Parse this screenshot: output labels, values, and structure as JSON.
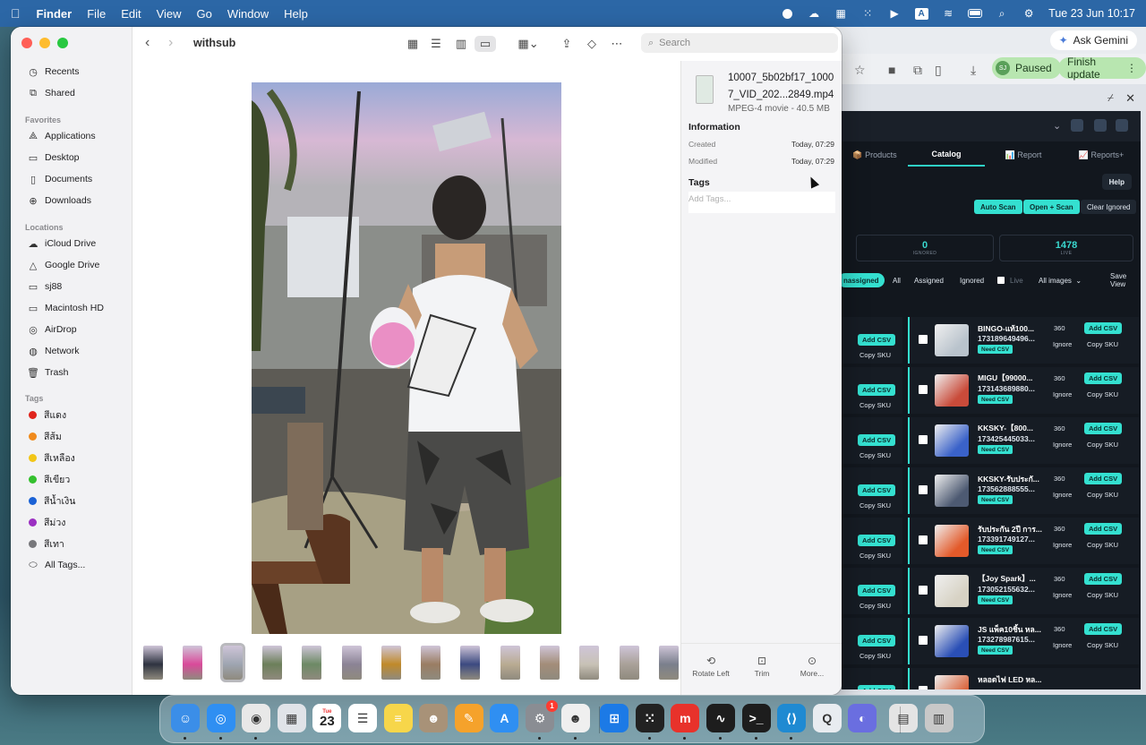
{
  "menubar": {
    "app": "Finder",
    "items": [
      "File",
      "Edit",
      "View",
      "Go",
      "Window",
      "Help"
    ],
    "datetime": "Tue 23 Jun  10:17",
    "status_icons": [
      "record-icon",
      "cloud-icon",
      "grid-icon",
      "dots-grid-icon",
      "play-icon",
      "keyboard-a-icon",
      "wifi-icon",
      "battery-icon",
      "search-icon",
      "control-center-icon"
    ],
    "keyboard_label": "A"
  },
  "finder": {
    "folder_title": "withsub",
    "search_placeholder": "Search",
    "sidebar": {
      "items_top": [
        {
          "label": "Recents",
          "icon": "clock-icon"
        },
        {
          "label": "Shared",
          "icon": "shared-folder-icon"
        }
      ],
      "favorites_header": "Favorites",
      "favorites": [
        {
          "label": "Applications",
          "icon": "applications-icon"
        },
        {
          "label": "Desktop",
          "icon": "desktop-icon"
        },
        {
          "label": "Documents",
          "icon": "document-icon"
        },
        {
          "label": "Downloads",
          "icon": "download-icon"
        }
      ],
      "locations_header": "Locations",
      "locations": [
        {
          "label": "iCloud Drive",
          "icon": "cloud-icon"
        },
        {
          "label": "Google Drive",
          "icon": "drive-icon"
        },
        {
          "label": "sj88",
          "icon": "external-disk-icon"
        },
        {
          "label": "Macintosh HD",
          "icon": "hard-disk-icon"
        },
        {
          "label": "AirDrop",
          "icon": "airdrop-icon"
        },
        {
          "label": "Network",
          "icon": "network-icon"
        },
        {
          "label": "Trash",
          "icon": "trash-icon"
        }
      ],
      "tags_header": "Tags",
      "tags": [
        {
          "label": "สีแดง",
          "color": "#e0241c"
        },
        {
          "label": "สีส้ม",
          "color": "#f08a1c"
        },
        {
          "label": "สีเหลือง",
          "color": "#f2c618"
        },
        {
          "label": "สีเขียว",
          "color": "#34c02e"
        },
        {
          "label": "สีน้ำเงิน",
          "color": "#1b62d6"
        },
        {
          "label": "สีม่วง",
          "color": "#9b30c2"
        },
        {
          "label": "สีเทา",
          "color": "#77777b"
        }
      ],
      "all_tags": "All Tags..."
    },
    "info": {
      "filename": "10007_5b02bf17_10007_VID_202...2849.mp4",
      "kind": "MPEG-4 movie - 40.5 MB",
      "information_header": "Information",
      "created_label": "Created",
      "created_value": "Today, 07:29",
      "modified_label": "Modified",
      "modified_value": "Today, 07:29",
      "tags_header": "Tags",
      "tags_placeholder": "Add Tags...",
      "actions": [
        {
          "label": "Rotate Left",
          "icon": "rotate-left-icon"
        },
        {
          "label": "Trim",
          "icon": "trim-icon"
        },
        {
          "label": "More...",
          "icon": "more-icon"
        }
      ]
    },
    "filmstrip_count": 14,
    "filmstrip_selected_index": 2
  },
  "browser": {
    "ask_gemini": "Ask Gemini",
    "paused_label": "Paused",
    "paused_avatar": "SJ",
    "finish_update": "Finish update",
    "extension": {
      "tabs": [
        "📦 Products",
        "Catalog",
        "📊 Report",
        "📈 Reports+"
      ],
      "active_tab": "Catalog",
      "help": "Help",
      "auto_scan": "Auto Scan",
      "open_scan": "Open + Scan",
      "clear_ignored": "Clear Ignored",
      "stats": [
        {
          "value": "0",
          "label": "IGNORED"
        },
        {
          "value": "1478",
          "label": "LIVE"
        }
      ],
      "filters": {
        "unassigned": "nassigned",
        "all": "All",
        "assigned": "Assigned",
        "ignored": "Ignored",
        "live": "Live",
        "all_images": "All images",
        "save_view": "Save View"
      },
      "row_buttons": {
        "add_csv": "Add CSV",
        "copy_sku": "Copy SKU",
        "ignore": "Ignore",
        "need_csv": "Need CSV"
      },
      "rows": [
        {
          "name": "BINGO-แท้100...",
          "sku": "173189649496...",
          "qty": "360",
          "thumb_color": "#b9c3cc"
        },
        {
          "name": "MIGU【99000...",
          "sku": "173143689880...",
          "qty": "360",
          "thumb_color": "#c94b3a"
        },
        {
          "name": "KKSKY-【800...",
          "sku": "173425445033...",
          "qty": "360",
          "thumb_color": "#3a62c9"
        },
        {
          "name": "KKSKY-รับประกั...",
          "sku": "173562888555...",
          "qty": "360",
          "thumb_color": "#4d5a72"
        },
        {
          "name": "รับประกัน 2ปี การ...",
          "sku": "173391749127...",
          "qty": "360",
          "thumb_color": "#e35a2a"
        },
        {
          "name": "【Joy Spark】...",
          "sku": "173052155632...",
          "qty": "360",
          "thumb_color": "#d7d2c4"
        },
        {
          "name": "JS แพ็ค10ชิ้น หล...",
          "sku": "173278987615...",
          "qty": "360",
          "thumb_color": "#2a4fb6"
        },
        {
          "name": "หลอดไฟ LED หล...",
          "sku": "",
          "qty": "",
          "thumb_color": "#d9633a"
        }
      ]
    }
  },
  "dock": {
    "calendar_day": "Tue",
    "calendar_date": "23",
    "settings_badge": "1",
    "apps": [
      {
        "name": "finder-icon",
        "color": "#3b8ee8"
      },
      {
        "name": "safari-icon",
        "color": "#2f8ff2"
      },
      {
        "name": "chrome-icon",
        "color": "#e8e8e8"
      },
      {
        "name": "launchpad-icon",
        "color": "#e0e3e8"
      },
      {
        "name": "calendar-icon",
        "color": "#ffffff"
      },
      {
        "name": "reminders-icon",
        "color": "#ffffff"
      },
      {
        "name": "notes-icon",
        "color": "#f7d64a"
      },
      {
        "name": "contacts-icon",
        "color": "#a89278"
      },
      {
        "name": "pages-icon",
        "color": "#f5a22b"
      },
      {
        "name": "app-store-icon",
        "color": "#2f8ff2"
      },
      {
        "name": "system-settings-icon",
        "color": "#8a8d93"
      },
      {
        "name": "character-app-icon",
        "color": "#efefef"
      },
      {
        "name": "windows-app-icon",
        "color": "#1c7ae6"
      },
      {
        "name": "dots-app-icon",
        "color": "#222222"
      },
      {
        "name": "mi-app-icon",
        "color": "#e8322b"
      },
      {
        "name": "activity-monitor-icon",
        "color": "#1d1d1d"
      },
      {
        "name": "terminal-icon",
        "color": "#1d1d1d"
      },
      {
        "name": "vscode-icon",
        "color": "#1f8ad2"
      },
      {
        "name": "quicktime-icon",
        "color": "#e8ecf0"
      },
      {
        "name": "screen-app-icon",
        "color": "#6a6ee0"
      },
      {
        "name": "downloads-stack-icon",
        "color": "#e4e4e4"
      },
      {
        "name": "trash-icon",
        "color": "#c8c8c8"
      }
    ]
  }
}
